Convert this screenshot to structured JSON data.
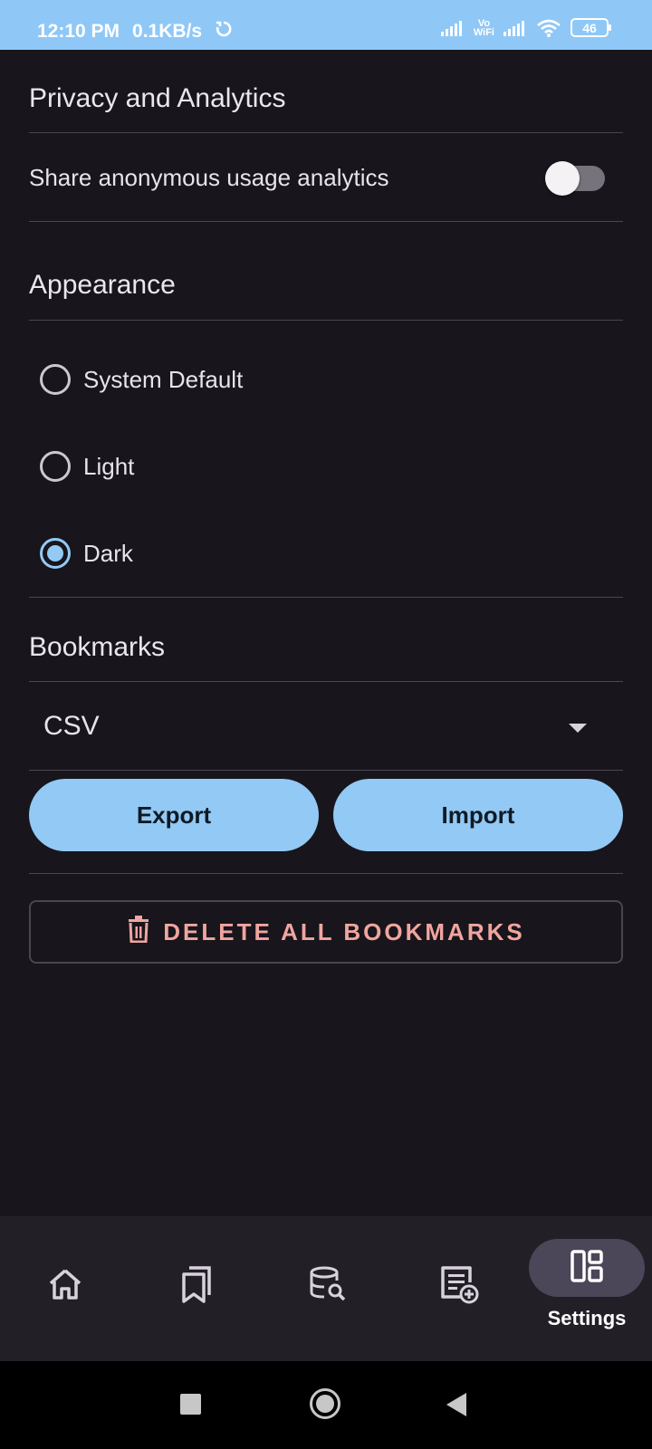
{
  "status_bar": {
    "time": "12:10 PM",
    "net_speed": "0.1KB/s",
    "vowifi_top": "Vo",
    "vowifi_bottom": "WiFi",
    "battery": "46"
  },
  "privacy": {
    "title": "Privacy and Analytics",
    "analytics_label": "Share anonymous usage analytics",
    "analytics_enabled": false
  },
  "appearance": {
    "title": "Appearance",
    "options": [
      {
        "label": "System Default",
        "selected": false
      },
      {
        "label": "Light",
        "selected": false
      },
      {
        "label": "Dark",
        "selected": true
      }
    ]
  },
  "bookmarks": {
    "title": "Bookmarks",
    "format_selected": "CSV",
    "export_label": "Export",
    "import_label": "Import",
    "delete_all_label": "DELETE ALL BOOKMARKS"
  },
  "bottom_nav": {
    "items": [
      {
        "icon": "home-icon"
      },
      {
        "icon": "bookmarks-icon"
      },
      {
        "icon": "database-search-icon"
      },
      {
        "icon": "note-add-icon"
      },
      {
        "icon": "settings-dashboard-icon",
        "label": "Settings",
        "active": true
      }
    ]
  },
  "colors": {
    "accent": "#92c9f5",
    "danger": "#f0a59e",
    "background": "#18151c"
  }
}
